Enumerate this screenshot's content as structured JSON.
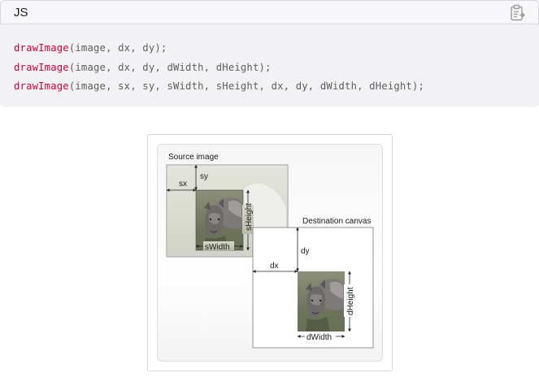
{
  "code_block": {
    "language": "JS",
    "copy_icon": "clipboard-icon",
    "lines": [
      {
        "fn": "drawImage",
        "args": "(image, dx, dy);"
      },
      {
        "fn": "drawImage",
        "args": "(image, dx, dy, dWidth, dHeight);"
      },
      {
        "fn": "drawImage",
        "args": "(image, sx, sy, sWidth, sHeight, dx, dy, dWidth, dHeight);"
      }
    ]
  },
  "figure": {
    "source_label": "Source image",
    "destination_label": "Destination canvas",
    "sx": "sx",
    "sy": "sy",
    "sWidth": "sWidth",
    "sHeight": "sHeight",
    "dx": "dx",
    "dy": "dy",
    "dWidth": "dWidth",
    "dHeight": "dHeight"
  }
}
